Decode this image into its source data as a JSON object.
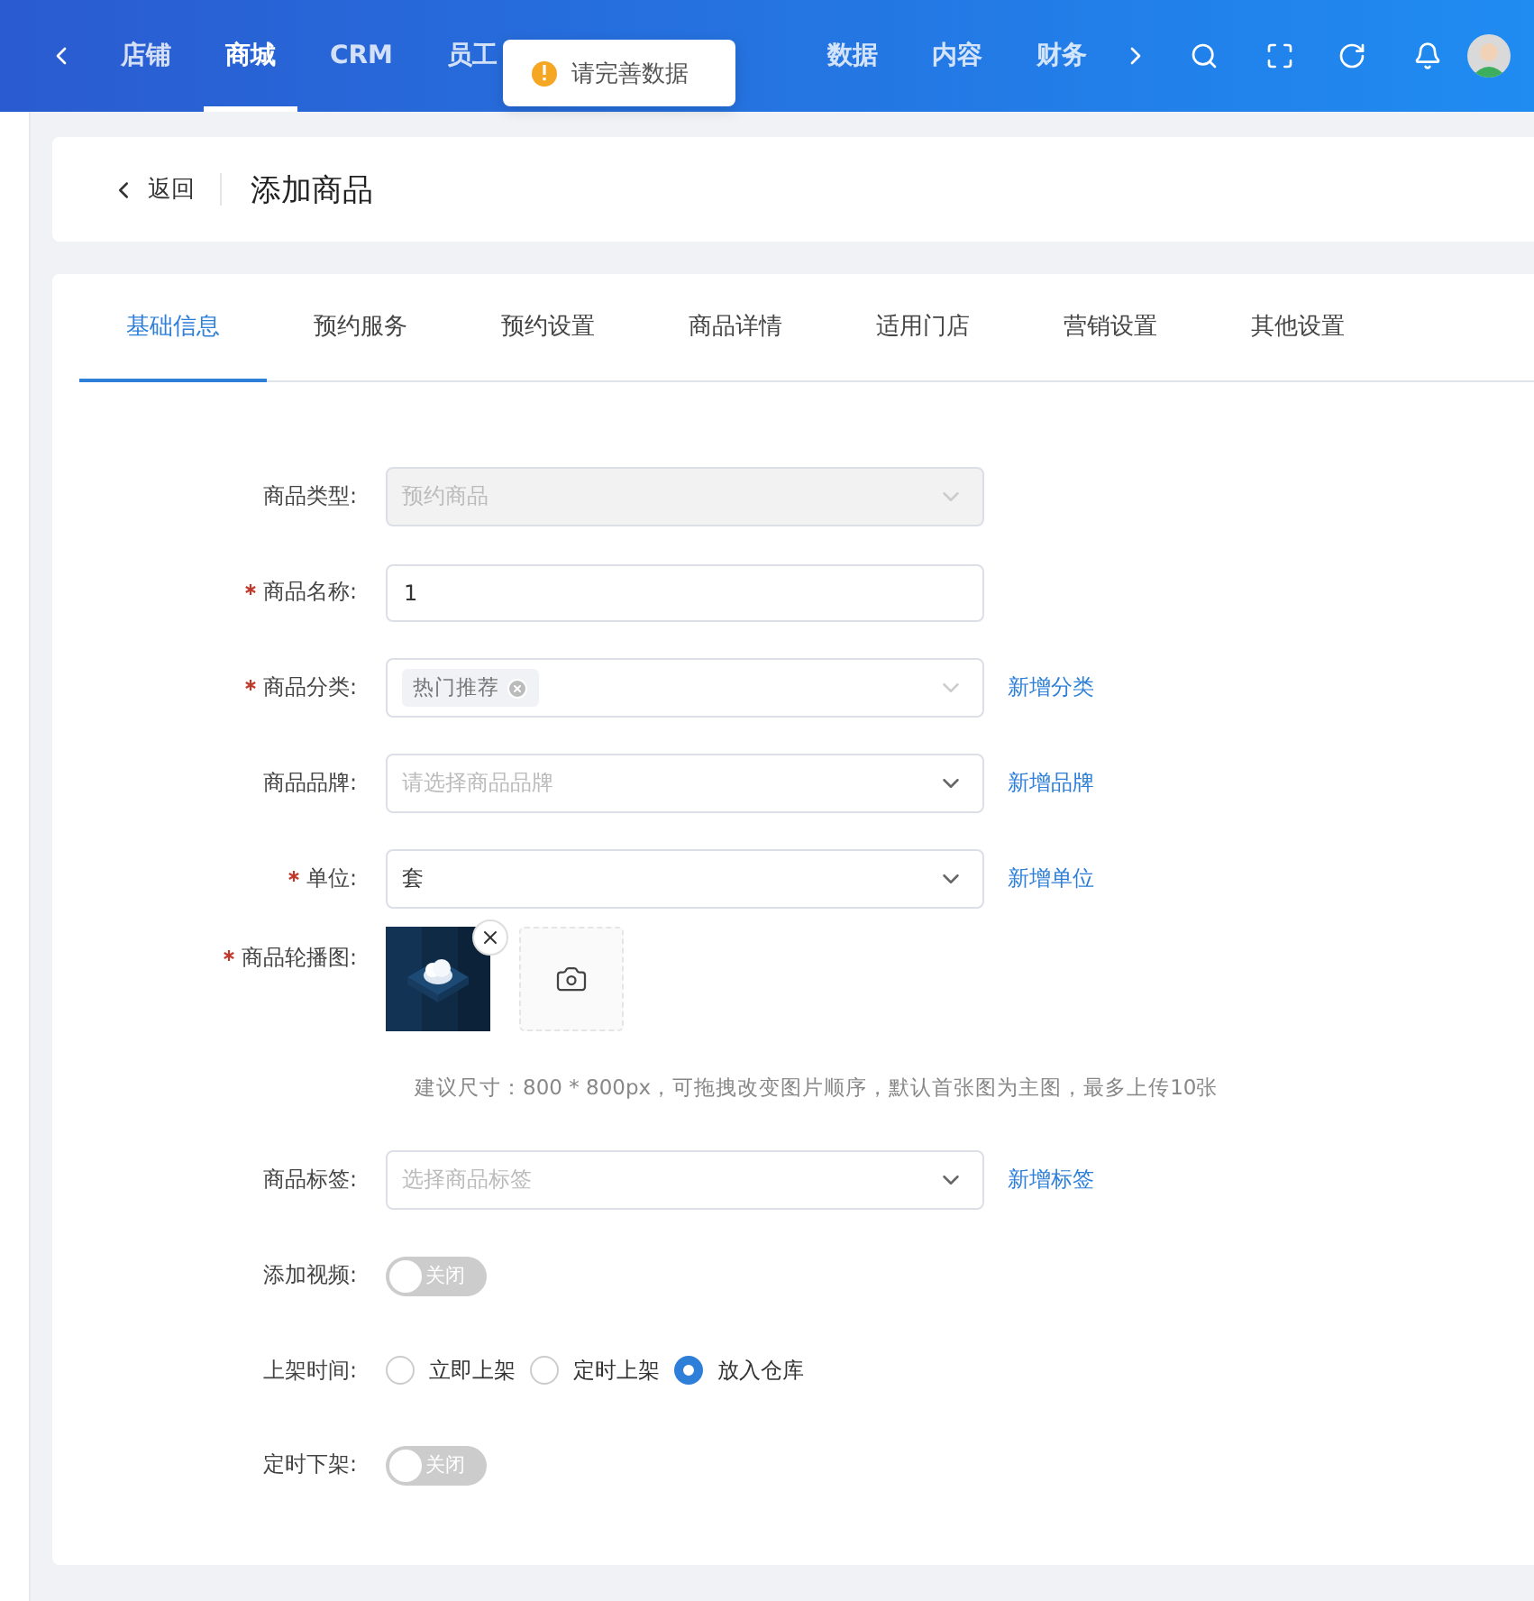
{
  "nav": {
    "items": [
      {
        "label": "店铺",
        "selected": false
      },
      {
        "label": "商城",
        "selected": true
      },
      {
        "label": "CRM",
        "selected": false
      },
      {
        "label": "员工",
        "selected": false
      },
      {
        "label": "数据",
        "selected": false
      },
      {
        "label": "内容",
        "selected": false
      },
      {
        "label": "财务",
        "selected": false
      }
    ]
  },
  "toast": {
    "text": "请完善数据"
  },
  "header": {
    "back": "返回",
    "title": "添加商品"
  },
  "tabs": [
    {
      "label": "基础信息",
      "selected": true
    },
    {
      "label": "预约服务",
      "selected": false
    },
    {
      "label": "预约设置",
      "selected": false
    },
    {
      "label": "商品详情",
      "selected": false
    },
    {
      "label": "适用门店",
      "selected": false
    },
    {
      "label": "营销设置",
      "selected": false
    },
    {
      "label": "其他设置",
      "selected": false
    }
  ],
  "form": [
    {
      "kind": "select",
      "label": "商品类型:",
      "required": false,
      "disabled": true,
      "value": "预约商品"
    },
    {
      "kind": "input",
      "label": "商品名称:",
      "required": true,
      "value": "1"
    },
    {
      "kind": "tags",
      "label": "商品分类:",
      "required": true,
      "tags": [
        "热门推荐"
      ],
      "link": "新增分类"
    },
    {
      "kind": "select",
      "label": "商品品牌:",
      "required": false,
      "disabled": false,
      "placeholder": "请选择商品品牌",
      "link": "新增品牌"
    },
    {
      "kind": "select",
      "label": "单位:",
      "required": true,
      "disabled": false,
      "value": "套",
      "link": "新增单位"
    },
    {
      "kind": "images",
      "label": "商品轮播图:",
      "required": true,
      "hint": "建议尺寸：800 * 800px，可拖拽改变图片顺序，默认首张图为主图，最多上传10张"
    },
    {
      "kind": "select",
      "label": "商品标签:",
      "required": false,
      "disabled": false,
      "placeholder": "选择商品标签",
      "link": "新增标签"
    },
    {
      "kind": "switch",
      "label": "添加视频:",
      "required": false,
      "on": false,
      "text": "关闭"
    },
    {
      "kind": "radio",
      "label": "上架时间:",
      "required": false,
      "options": [
        {
          "label": "立即上架",
          "selected": false
        },
        {
          "label": "定时上架",
          "selected": false
        },
        {
          "label": "放入仓库",
          "selected": true
        }
      ]
    },
    {
      "kind": "switch",
      "label": "定时下架:",
      "required": false,
      "on": false,
      "text": "关闭"
    }
  ]
}
